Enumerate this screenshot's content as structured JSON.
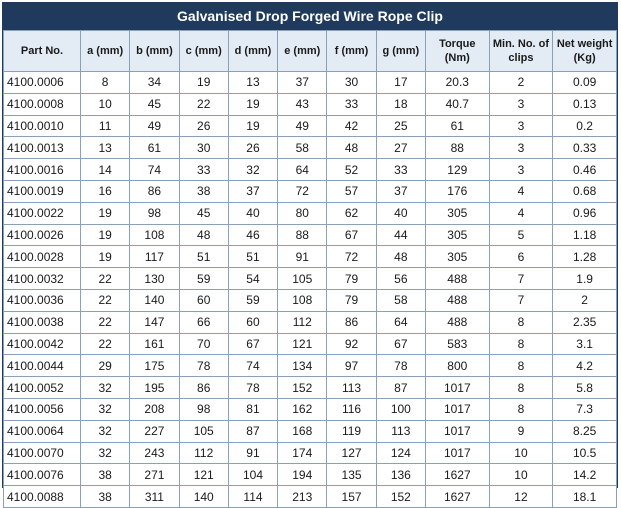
{
  "title": "Galvanised Drop Forged Wire Rope Clip",
  "columns": [
    "Part No.",
    "a (mm)",
    "b (mm)",
    "c (mm)",
    "d (mm)",
    "e (mm)",
    "f (mm)",
    "g (mm)",
    "Torque (Nm)",
    "Min. No. of clips",
    "Net weight (Kg)"
  ],
  "rows": [
    [
      "4100.0006",
      "8",
      "34",
      "19",
      "13",
      "37",
      "30",
      "17",
      "20.3",
      "2",
      "0.09"
    ],
    [
      "4100.0008",
      "10",
      "45",
      "22",
      "19",
      "43",
      "33",
      "18",
      "40.7",
      "3",
      "0.13"
    ],
    [
      "4100.0010",
      "11",
      "49",
      "26",
      "19",
      "49",
      "42",
      "25",
      "61",
      "3",
      "0.2"
    ],
    [
      "4100.0013",
      "13",
      "61",
      "30",
      "26",
      "58",
      "48",
      "27",
      "88",
      "3",
      "0.33"
    ],
    [
      "4100.0016",
      "14",
      "74",
      "33",
      "32",
      "64",
      "52",
      "33",
      "129",
      "3",
      "0.46"
    ],
    [
      "4100.0019",
      "16",
      "86",
      "38",
      "37",
      "72",
      "57",
      "37",
      "176",
      "4",
      "0.68"
    ],
    [
      "4100.0022",
      "19",
      "98",
      "45",
      "40",
      "80",
      "62",
      "40",
      "305",
      "4",
      "0.96"
    ],
    [
      "4100.0026",
      "19",
      "108",
      "48",
      "46",
      "88",
      "67",
      "44",
      "305",
      "5",
      "1.18"
    ],
    [
      "4100.0028",
      "19",
      "117",
      "51",
      "51",
      "91",
      "72",
      "48",
      "305",
      "6",
      "1.28"
    ],
    [
      "4100.0032",
      "22",
      "130",
      "59",
      "54",
      "105",
      "79",
      "56",
      "488",
      "7",
      "1.9"
    ],
    [
      "4100.0036",
      "22",
      "140",
      "60",
      "59",
      "108",
      "79",
      "58",
      "488",
      "7",
      "2"
    ],
    [
      "4100.0038",
      "22",
      "147",
      "66",
      "60",
      "112",
      "86",
      "64",
      "488",
      "8",
      "2.35"
    ],
    [
      "4100.0042",
      "22",
      "161",
      "70",
      "67",
      "121",
      "92",
      "67",
      "583",
      "8",
      "3.1"
    ],
    [
      "4100.0044",
      "29",
      "175",
      "78",
      "74",
      "134",
      "97",
      "78",
      "800",
      "8",
      "4.2"
    ],
    [
      "4100.0052",
      "32",
      "195",
      "86",
      "78",
      "152",
      "113",
      "87",
      "1017",
      "8",
      "5.8"
    ],
    [
      "4100.0056",
      "32",
      "208",
      "98",
      "81",
      "162",
      "116",
      "100",
      "1017",
      "8",
      "7.3"
    ],
    [
      "4100.0064",
      "32",
      "227",
      "105",
      "87",
      "168",
      "119",
      "113",
      "1017",
      "9",
      "8.25"
    ],
    [
      "4100.0070",
      "32",
      "243",
      "112",
      "91",
      "174",
      "127",
      "124",
      "1017",
      "10",
      "10.5"
    ],
    [
      "4100.0076",
      "38",
      "271",
      "121",
      "104",
      "194",
      "135",
      "136",
      "1627",
      "10",
      "14.2"
    ],
    [
      "4100.0088",
      "38",
      "311",
      "140",
      "114",
      "213",
      "157",
      "152",
      "1627",
      "12",
      "18.1"
    ]
  ]
}
